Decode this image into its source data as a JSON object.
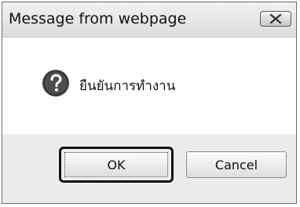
{
  "window": {
    "title": "Message from webpage"
  },
  "message": {
    "text": "ยืนยันการทำงาน",
    "icon": "question-icon"
  },
  "buttons": {
    "ok_label": "OK",
    "cancel_label": "Cancel"
  },
  "colors": {
    "dialog_background": "#e9e9e9",
    "content_background": "#ffffff",
    "icon_fill": "#3a3a3a",
    "focus_ring": "#111111"
  }
}
